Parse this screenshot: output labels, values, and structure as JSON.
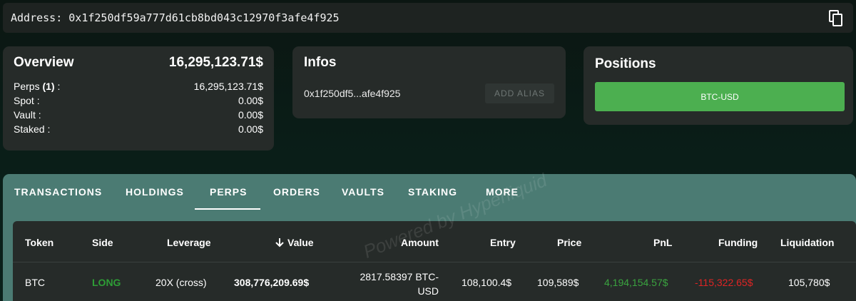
{
  "address": {
    "label": "Address: 0x1f250df59a777d61cb8bd043c12970f3afe4f925",
    "copy_icon": "copy-icon"
  },
  "overview": {
    "title": "Overview",
    "total": "16,295,123.71$",
    "rows": [
      {
        "label_main": "Perps ",
        "label_count": "(1)",
        "label_suffix": " :",
        "value": "16,295,123.71$"
      },
      {
        "label_main": "Spot :",
        "value": "0.00$"
      },
      {
        "label_main": "Vault :",
        "value": "0.00$"
      },
      {
        "label_main": "Staked :",
        "value": "0.00$"
      }
    ]
  },
  "infos": {
    "title": "Infos",
    "short_address": "0x1f250df5...afe4f925",
    "add_alias_label": "ADD ALIAS"
  },
  "positions": {
    "title": "Positions",
    "items": [
      "BTC-USD"
    ],
    "accent": "#4caf50"
  },
  "tabs": {
    "items": [
      "TRANSACTIONS",
      "HOLDINGS",
      "PERPS",
      "ORDERS",
      "VAULTS",
      "STAKING",
      "MORE"
    ],
    "active": "PERPS"
  },
  "table": {
    "headers": [
      "Token",
      "Side",
      "Leverage",
      "Value",
      "Amount",
      "Entry",
      "Price",
      "PnL",
      "Funding",
      "Liquidation"
    ],
    "sort_icon": "arrow-down-icon",
    "rows": [
      {
        "token": "BTC",
        "side": "LONG",
        "leverage": "20X (cross)",
        "value": "308,776,209.69$",
        "amount_line1": "2817.58397 BTC-",
        "amount_line2": "USD",
        "entry": "108,100.4$",
        "price": "109,589$",
        "pnl": "4,194,154.57$",
        "funding": "-115,322.65$",
        "liquidation": "105,780$"
      }
    ],
    "colors": {
      "long": "#2e9e36",
      "pnl_positive": "#3aa33f",
      "funding_negative": "#e02424"
    }
  },
  "watermark": "Powered by Hyperliquid"
}
